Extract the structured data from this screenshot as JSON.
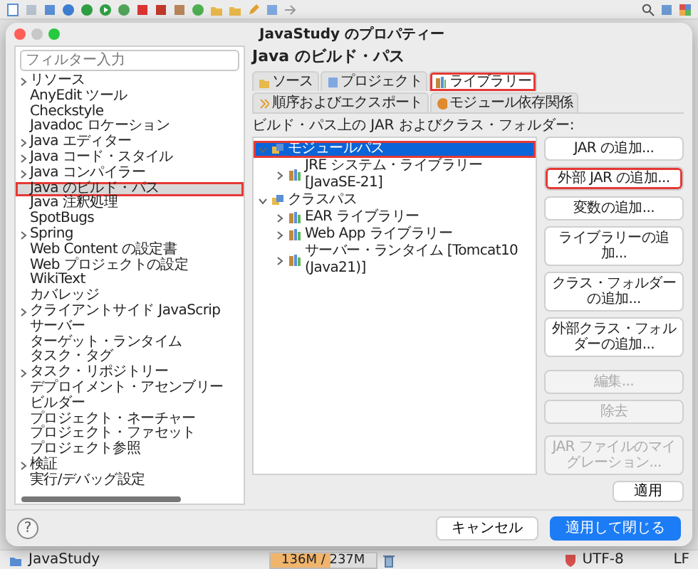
{
  "dialog": {
    "title": "JavaStudy のプロパティー",
    "filter_placeholder": "フィルター入力",
    "categories": [
      {
        "label": "リソース",
        "expandable": true,
        "selected": false,
        "annotated": false
      },
      {
        "label": "AnyEdit ツール",
        "expandable": false,
        "selected": false,
        "annotated": false
      },
      {
        "label": "Checkstyle",
        "expandable": false,
        "selected": false,
        "annotated": false
      },
      {
        "label": "Javadoc ロケーション",
        "expandable": false,
        "selected": false,
        "annotated": false
      },
      {
        "label": "Java エディター",
        "expandable": true,
        "selected": false,
        "annotated": false
      },
      {
        "label": "Java コード・スタイル",
        "expandable": true,
        "selected": false,
        "annotated": false
      },
      {
        "label": "Java コンパイラー",
        "expandable": true,
        "selected": false,
        "annotated": false
      },
      {
        "label": "Java のビルド・パス",
        "expandable": false,
        "selected": true,
        "annotated": true
      },
      {
        "label": "Java 注釈処理",
        "expandable": false,
        "selected": false,
        "annotated": false
      },
      {
        "label": "SpotBugs",
        "expandable": false,
        "selected": false,
        "annotated": false
      },
      {
        "label": "Spring",
        "expandable": true,
        "selected": false,
        "annotated": false
      },
      {
        "label": "Web Content の設定書",
        "expandable": false,
        "selected": false,
        "annotated": false
      },
      {
        "label": "Web プロジェクトの設定",
        "expandable": false,
        "selected": false,
        "annotated": false
      },
      {
        "label": "WikiText",
        "expandable": false,
        "selected": false,
        "annotated": false
      },
      {
        "label": "カバレッジ",
        "expandable": false,
        "selected": false,
        "annotated": false
      },
      {
        "label": "クライアントサイド JavaScrip",
        "expandable": true,
        "selected": false,
        "annotated": false
      },
      {
        "label": "サーバー",
        "expandable": false,
        "selected": false,
        "annotated": false
      },
      {
        "label": "ターゲット・ランタイム",
        "expandable": false,
        "selected": false,
        "annotated": false
      },
      {
        "label": "タスク・タグ",
        "expandable": false,
        "selected": false,
        "annotated": false
      },
      {
        "label": "タスク・リポジトリー",
        "expandable": true,
        "selected": false,
        "annotated": false
      },
      {
        "label": "デプロイメント・アセンブリー",
        "expandable": false,
        "selected": false,
        "annotated": false
      },
      {
        "label": "ビルダー",
        "expandable": false,
        "selected": false,
        "annotated": false
      },
      {
        "label": "プロジェクト・ネーチャー",
        "expandable": false,
        "selected": false,
        "annotated": false
      },
      {
        "label": "プロジェクト・ファセット",
        "expandable": false,
        "selected": false,
        "annotated": false
      },
      {
        "label": "プロジェクト参照",
        "expandable": false,
        "selected": false,
        "annotated": false
      },
      {
        "label": "検証",
        "expandable": true,
        "selected": false,
        "annotated": false
      },
      {
        "label": "実行/デバッグ設定",
        "expandable": false,
        "selected": false,
        "annotated": false
      }
    ],
    "page_title": "Java のビルド・パス",
    "tabs": [
      {
        "label": "ソース",
        "selected": false,
        "annotated": false
      },
      {
        "label": "プロジェクト",
        "selected": false,
        "annotated": false
      },
      {
        "label": "ライブラリー",
        "selected": true,
        "annotated": true
      },
      {
        "label": "順序およびエクスポート",
        "selected": false,
        "annotated": false
      },
      {
        "label": "モジュール依存関係",
        "selected": false,
        "annotated": false
      }
    ],
    "list_label": "ビルド・パス上の JAR およびクラス・フォルダー:",
    "tree": [
      {
        "label": "モジュールパス",
        "expanded": true,
        "selected": true,
        "annotated": true,
        "children": [
          {
            "label": "JRE システム・ライブラリー [JavaSE-21]",
            "expanded": false,
            "selected": false,
            "annotated": false
          }
        ]
      },
      {
        "label": "クラスパス",
        "expanded": true,
        "selected": false,
        "annotated": false,
        "children": [
          {
            "label": "EAR ライブラリー",
            "expanded": false,
            "selected": false,
            "annotated": false
          },
          {
            "label": "Web App ライブラリー",
            "expanded": false,
            "selected": false,
            "annotated": false
          },
          {
            "label": "サーバー・ランタイム [Tomcat10 (Java21)]",
            "expanded": false,
            "selected": false,
            "annotated": false
          }
        ]
      }
    ],
    "side_buttons": [
      {
        "label": "JAR の追加...",
        "disabled": false,
        "annotated": false
      },
      {
        "label": "外部 JAR の追加...",
        "disabled": false,
        "annotated": true
      },
      {
        "label": "変数の追加...",
        "disabled": false,
        "annotated": false
      },
      {
        "label": "ライブラリーの追加...",
        "disabled": false,
        "annotated": false
      },
      {
        "label": "クラス・フォルダーの追加...",
        "disabled": false,
        "annotated": false
      },
      {
        "label": "外部クラス・フォルダーの追加...",
        "disabled": false,
        "annotated": false
      },
      {
        "label": "編集...",
        "disabled": true,
        "annotated": false
      },
      {
        "label": "除去",
        "disabled": true,
        "annotated": false
      },
      {
        "label": "JAR ファイルのマイグレーション...",
        "disabled": true,
        "annotated": false
      }
    ],
    "apply_button": "適用",
    "help_button": "?",
    "cancel_button": "キャンセル",
    "apply_close_button": "適用して閉じる"
  },
  "status_bar": {
    "project": "JavaStudy",
    "heap": {
      "reading": "136M / 237M",
      "level": 0.57
    },
    "encoding": "UTF-8",
    "line_delimiter": "LF"
  }
}
